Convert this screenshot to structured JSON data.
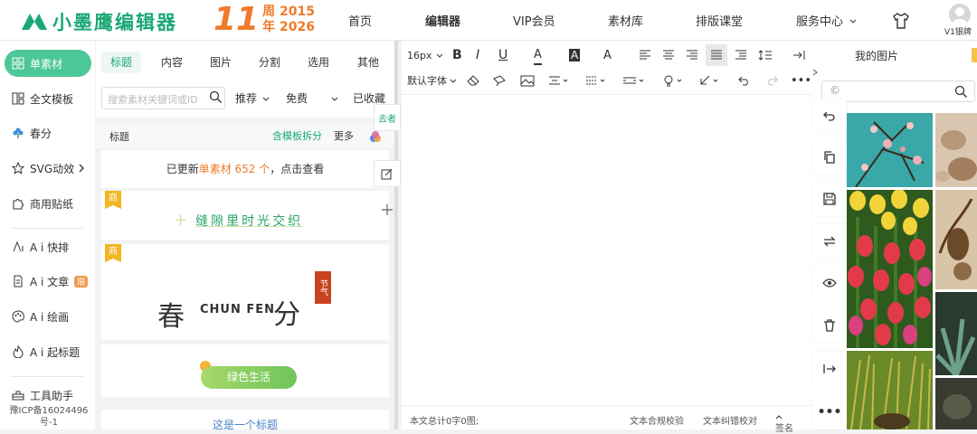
{
  "app": {
    "name": "小墨鹰编辑器",
    "anniv_big": "11",
    "anniv_word1": "周",
    "anniv_year1": "2015",
    "anniv_word2": "年",
    "anniv_year2": "2026"
  },
  "nav": [
    {
      "label": "首页"
    },
    {
      "label": "编辑器"
    },
    {
      "label": "VIP会员"
    },
    {
      "label": "素材库"
    },
    {
      "label": "排版课堂"
    },
    {
      "label": "服务中心"
    }
  ],
  "user": {
    "tag": "V1银牌"
  },
  "sidebar": {
    "items": [
      {
        "label": "单素材"
      },
      {
        "label": "全文模板"
      },
      {
        "label": "春分"
      },
      {
        "label": "SVG动效"
      },
      {
        "label": "商用贴纸"
      },
      {
        "label": "A i 快排"
      },
      {
        "label": "A i 文章",
        "badge": "限"
      },
      {
        "label": "A i 绘画"
      },
      {
        "label": "A i 起标题"
      },
      {
        "label": "工具助手"
      }
    ],
    "icp": "豫ICP备16024496号-1"
  },
  "panel": {
    "tabs": [
      "标题",
      "内容",
      "图片",
      "分割",
      "选用",
      "其他"
    ],
    "search_placeholder": "搜索素材关键词或ID",
    "filters": [
      "推荐",
      "免费",
      "已收藏"
    ],
    "subhead": {
      "label": "标题",
      "link": "含模板拆分",
      "more": "更多"
    },
    "update_text": {
      "pre": "已更新",
      "highlight": "单素材 652 个",
      "post": "，点击查看"
    },
    "cards": [
      {
        "badge": "商",
        "title": "缝隙里时光交织"
      },
      {
        "badge": "商",
        "cn1": "春",
        "en": "CHUN FEN",
        "cn2": "分",
        "seal": "节气"
      },
      {
        "title": "绿色生活"
      },
      {
        "title": "这是一个标题"
      }
    ]
  },
  "float": {
    "label": "去者"
  },
  "toolbar": {
    "font_size": "16px",
    "font_family": "默认字体"
  },
  "status": {
    "count": "本文总计0字0图;",
    "compliance": "文本合规校验",
    "proofread": "文本纠错校对",
    "sign": "签名"
  },
  "images_panel": {
    "tab": "我的图片",
    "search_icon_label": "©"
  },
  "colors": {
    "brand": "#1aa874",
    "accent": "#f07a2a",
    "active_bg": "#4cc797"
  }
}
